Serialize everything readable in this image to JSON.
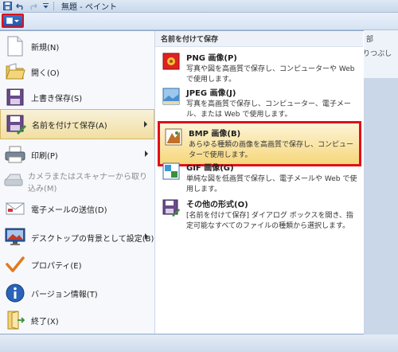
{
  "window": {
    "title": "無題 - ペイント"
  },
  "ribbon": {
    "remnant_1": "部",
    "remnant_2": "りつぶし"
  },
  "menu": {
    "left_items": [
      {
        "label": "新規(N)",
        "icon": "new-document-icon",
        "has_submenu": false,
        "disabled": false
      },
      {
        "label": "開く(O)",
        "icon": "open-folder-icon",
        "has_submenu": false,
        "disabled": false
      },
      {
        "label": "上書き保存(S)",
        "icon": "save-disk-icon",
        "has_submenu": false,
        "disabled": false
      },
      {
        "label": "名前を付けて保存(A)",
        "icon": "save-as-icon",
        "has_submenu": true,
        "disabled": false
      },
      {
        "label": "印刷(P)",
        "icon": "printer-icon",
        "has_submenu": true,
        "disabled": false
      },
      {
        "label": "カメラまたはスキャナーから取り込み(M)",
        "icon": "scanner-icon",
        "has_submenu": false,
        "disabled": true
      },
      {
        "label": "電子メールの送信(D)",
        "icon": "email-icon",
        "has_submenu": false,
        "disabled": false
      },
      {
        "label": "デスクトップの背景として設定(B)",
        "icon": "desktop-background-icon",
        "has_submenu": true,
        "disabled": false
      },
      {
        "label": "プロパティ(E)",
        "icon": "checkmark-properties-icon",
        "has_submenu": false,
        "disabled": false
      },
      {
        "label": "バージョン情報(T)",
        "icon": "info-icon",
        "has_submenu": false,
        "disabled": false
      },
      {
        "label": "終了(X)",
        "icon": "exit-icon",
        "has_submenu": false,
        "disabled": false
      }
    ],
    "right_header": "名前を付けて保存",
    "right_items": [
      {
        "title": "PNG 画像(P)",
        "desc": "写真や図を高画質で保存し、コンピューターや Web で使用します。",
        "icon": "png-image-icon"
      },
      {
        "title": "JPEG 画像(J)",
        "desc": "写真を高画質で保存し、コンピューター、電子メール、または Web で使用します。",
        "icon": "jpeg-image-icon"
      },
      {
        "title": "BMP 画像(B)",
        "desc": "あらゆる種類の画像を高画質で保存し、コンピューターで使用します。",
        "icon": "bmp-image-icon"
      },
      {
        "title": "GIF 画像(G)",
        "desc": "単純な図を低画質で保存し、電子メールや Web で使用します。",
        "icon": "gif-image-icon"
      },
      {
        "title": "その他の形式(O)",
        "desc": "[名前を付けて保存] ダイアログ ボックスを開き、指定可能なすべてのファイルの種類から選択します。",
        "icon": "other-formats-icon"
      }
    ]
  },
  "colors": {
    "highlight_border": "#e0101a",
    "hover_fill": "#f6d77b",
    "app_button": "#1f56a8"
  }
}
